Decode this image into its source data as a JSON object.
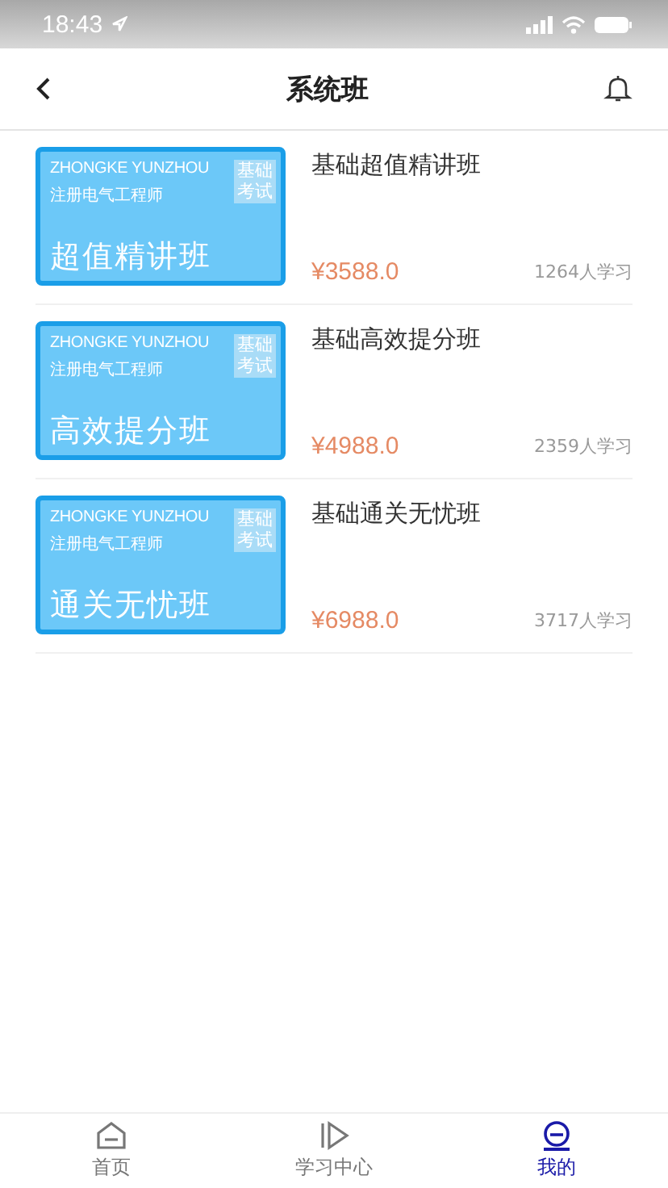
{
  "status_bar": {
    "time": "18:43"
  },
  "header": {
    "title": "系统班"
  },
  "courses": [
    {
      "cover": {
        "brand": "ZHONGKE YUNZHOU",
        "subject": "注册电气工程师",
        "tag": "基础考试",
        "headline": "超值精讲班"
      },
      "title": "基础超值精讲班",
      "price": "¥3588.0",
      "learners": "1264人学习"
    },
    {
      "cover": {
        "brand": "ZHONGKE YUNZHOU",
        "subject": "注册电气工程师",
        "tag": "基础考试",
        "headline": "高效提分班"
      },
      "title": "基础高效提分班",
      "price": "¥4988.0",
      "learners": "2359人学习"
    },
    {
      "cover": {
        "brand": "ZHONGKE YUNZHOU",
        "subject": "注册电气工程师",
        "tag": "基础考试",
        "headline": "通关无忧班"
      },
      "title": "基础通关无忧班",
      "price": "¥6988.0",
      "learners": "3717人学习"
    }
  ],
  "tab_bar": [
    {
      "label": "首页",
      "kind": "home",
      "selected": false
    },
    {
      "label": "学习中心",
      "kind": "study",
      "selected": false
    },
    {
      "label": "我的",
      "kind": "me",
      "selected": true
    }
  ]
}
